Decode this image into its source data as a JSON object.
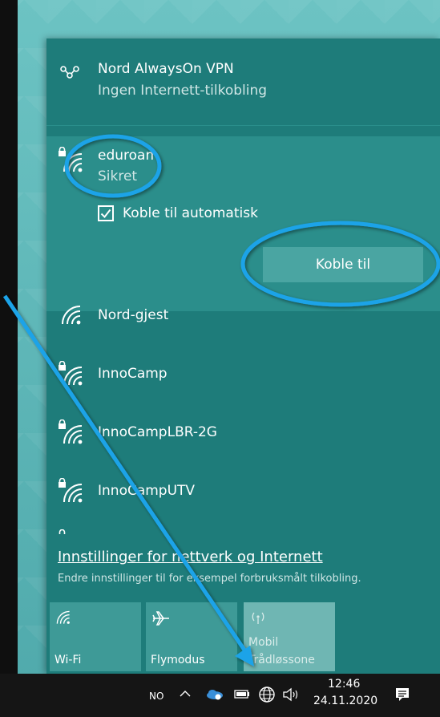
{
  "vpn": {
    "name": "Nord AlwaysOn VPN",
    "status": "Ingen Internett-tilkobling"
  },
  "selected_network": {
    "name": "eduroam",
    "security": "Sikret",
    "auto_connect_label": "Koble til automatisk",
    "auto_connect_checked": true,
    "connect_label": "Koble til"
  },
  "networks": [
    {
      "name": "Nord-gjest",
      "secured": false
    },
    {
      "name": "InnoCamp",
      "secured": true
    },
    {
      "name": "InnoCampLBR-2G",
      "secured": true
    },
    {
      "name": "InnoCampUTV",
      "secured": true
    }
  ],
  "settings": {
    "link_label": "Innstillinger for nettverk og Internett",
    "description": "Endre innstillinger til for eksempel forbruksmålt tilkobling."
  },
  "quick_actions": [
    {
      "label": "Wi-Fi",
      "icon": "wifi-icon",
      "active": true
    },
    {
      "label": "Flymodus",
      "icon": "airplane-icon",
      "active": true
    },
    {
      "label": "Mobil Hotspot",
      "label_line1": "Mobil",
      "label_line2": "Trådløssone",
      "icon": "hotspot-icon",
      "active": false
    }
  ],
  "taskbar": {
    "language": "NO",
    "time": "12:46",
    "date": "24.11.2020"
  },
  "colors": {
    "flyout_bg": "#1e7c7a",
    "selected_bg": "#2b8e8b",
    "button_bg": "#4aa5a2",
    "annotation": "#1aa3e8",
    "taskbar_bg": "#151515"
  }
}
